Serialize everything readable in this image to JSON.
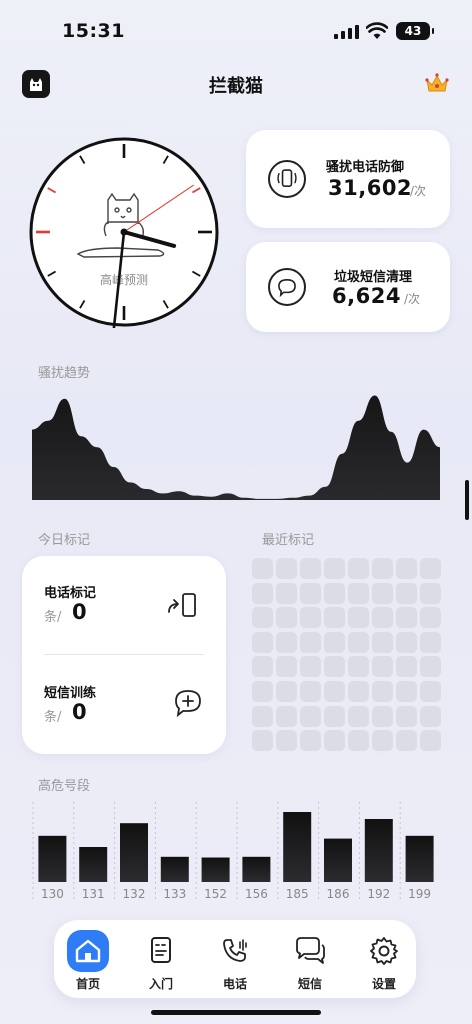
{
  "status_bar": {
    "time": "15:31",
    "battery": "43"
  },
  "header": {
    "title": "拦截猫",
    "logo_icon": "cat-logo-icon",
    "crown_icon": "crown-icon"
  },
  "clock": {
    "label": "高峰预测",
    "time_shown": "15:31"
  },
  "stats": [
    {
      "label": "骚扰电话防御",
      "value": "31,602",
      "unit": "/次",
      "icon": "phone-vibrate-icon"
    },
    {
      "label": "垃圾短信清理",
      "value": "6,624",
      "unit": "/次",
      "icon": "message-bubble-icon"
    }
  ],
  "trend": {
    "label": "骚扰趋势",
    "chart_data": {
      "type": "area",
      "values": [
        0.64,
        0.72,
        0.92,
        0.58,
        0.48,
        0.3,
        0.16,
        0.1,
        0.06,
        0.08,
        0.04,
        0.03,
        0.06,
        0.02,
        0.01,
        0.01,
        0.02,
        0.04,
        0.12,
        0.42,
        0.72,
        0.95,
        0.62,
        0.34,
        0.64,
        0.48
      ]
    }
  },
  "today_marks": {
    "label": "今日标记",
    "rows": [
      {
        "title": "电话标记",
        "unit": "条/",
        "value": "0",
        "icon": "call-forward-icon"
      },
      {
        "title": "短信训练",
        "unit": "条/",
        "value": "0",
        "icon": "message-add-icon"
      }
    ]
  },
  "recent_marks": {
    "label": "最近标记",
    "rows": 8,
    "cols": 8
  },
  "high_risk": {
    "label": "高危号段",
    "chart_data": {
      "type": "bar",
      "categories": [
        "130",
        "131",
        "132",
        "133",
        "152",
        "156",
        "185",
        "186",
        "192",
        "199"
      ],
      "values": [
        0.66,
        0.5,
        0.84,
        0.36,
        0.35,
        0.36,
        1.0,
        0.62,
        0.9,
        0.66
      ]
    }
  },
  "tabbar": {
    "items": [
      {
        "label": "首页",
        "icon": "home-icon",
        "active": true
      },
      {
        "label": "入门",
        "icon": "guide-card-icon",
        "active": false
      },
      {
        "label": "电话",
        "icon": "phone-call-icon",
        "active": false
      },
      {
        "label": "短信",
        "icon": "chat-bubbles-icon",
        "active": false
      },
      {
        "label": "设置",
        "icon": "gear-icon",
        "active": false
      }
    ]
  },
  "colors": {
    "accent": "#2e7df6",
    "dark": "#141414",
    "card": "#ffffff",
    "grid_cell": "#dcdce6",
    "clock_red": "#e53935"
  }
}
